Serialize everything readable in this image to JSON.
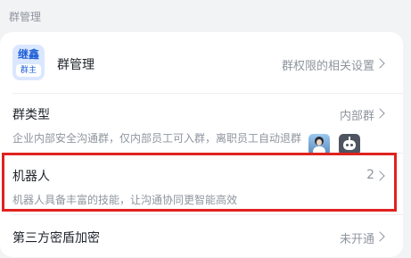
{
  "section_title": "群管理",
  "group_manage": {
    "avatar_top": "继鑫",
    "avatar_bottom": "群主",
    "title": "群管理",
    "right_text": "群权限的相关设置"
  },
  "group_type": {
    "title": "群类型",
    "right_text": "内部群",
    "description": "企业内部安全沟通群，仅内部员工可入群，离职员工自动退群"
  },
  "robots": {
    "title": "机器人",
    "count": "2",
    "description": "机器人具备丰富的技能，让沟通协同更智能高效",
    "highlight_color": "#e0221f"
  },
  "encryption": {
    "title": "第三方密盾加密",
    "right_text": "未开通"
  },
  "icons": {
    "chevron": "chevron-right-icon",
    "robot_avatar_1": "person-avatar",
    "robot_avatar_2": "robot-icon"
  }
}
